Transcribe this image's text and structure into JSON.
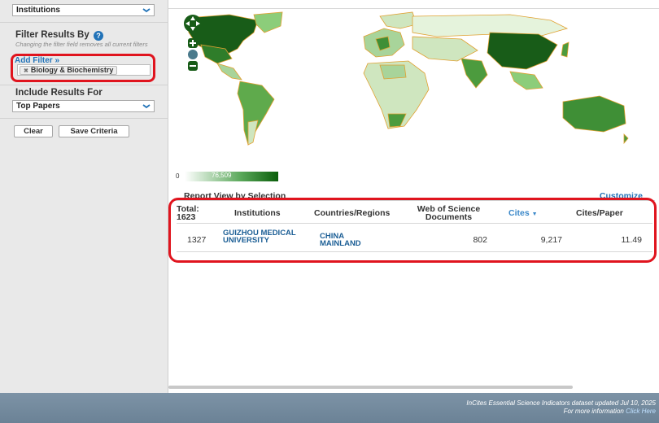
{
  "sidebar": {
    "entity_select": "Institutions",
    "filter_title": "Filter Results By",
    "filter_help_icon": "?",
    "filter_hint": "Changing the filter field removes all current filters",
    "add_filter": "Add Filter »",
    "active_filter": "Biology & Biochemistry",
    "include_title": "Include Results For",
    "include_select": "Top Papers",
    "clear_label": "Clear",
    "save_label": "Save Criteria"
  },
  "map": {
    "legend_min": "0",
    "legend_max": "76,509",
    "colors": {
      "light": "#cfe6bf",
      "mid": "#4c9b3e",
      "dark": "#185c18",
      "border": "#e0a030"
    }
  },
  "report": {
    "title": "Report View by Selection",
    "customize": "Customize",
    "columns": {
      "total_label": "Total:",
      "total_count": "1623",
      "institutions": "Institutions",
      "countries": "Countries/Regions",
      "wos_docs": "Web of Science Documents",
      "cites": "Cites",
      "cites_sort_icon": "▼",
      "cites_per_paper": "Cites/Paper"
    },
    "rows": [
      {
        "rank": "1327",
        "institution": "GUIZHOU MEDICAL UNIVERSITY",
        "country": "CHINA MAINLAND",
        "docs": "802",
        "cites": "9,217",
        "cites_per_paper": "11.49"
      }
    ]
  },
  "footer": {
    "line1": "InCites Essential Science Indicators dataset updated Jul 10, 2025",
    "line2_prefix": "For more information",
    "line2_link": "Click Here"
  }
}
